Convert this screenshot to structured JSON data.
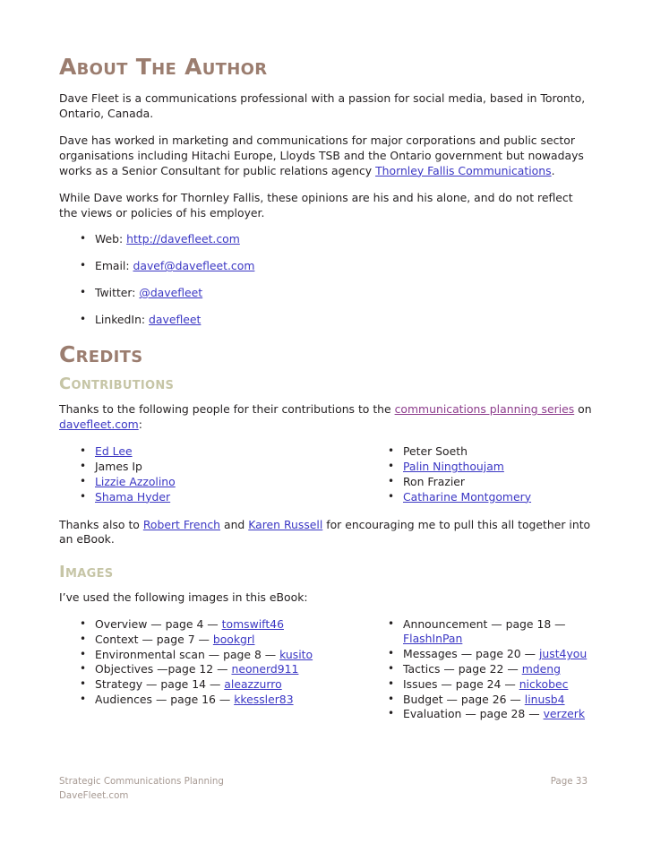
{
  "document": {
    "sections": {
      "author": {
        "heading": "About The Author",
        "paragraph_1": "Dave Fleet is a communications professional with a passion for social media, based in Toronto, Ontario, Canada.",
        "paragraph_2_part_1": "Dave has worked in marketing and communications for major corporations and public sector organisations including Hitachi Europe, Lloyds TSB and the Ontario government but nowadays works as a Senior Consultant for public relations agency ",
        "paragraph_2_link": "Thornley Fallis Communications",
        "paragraph_2_part_2": ".",
        "paragraph_3": "While Dave works for Thornley Fallis, these opinions are his and his alone, and do not reflect the views or policies of his employer.",
        "contacts": [
          {
            "label": "Web: ",
            "value": "http://davefleet.com",
            "is_link": true
          },
          {
            "label": "Email: ",
            "value": "davef@davefleet.com",
            "is_link": true
          },
          {
            "label": "Twitter: ",
            "value": "@davefleet",
            "is_link": true
          },
          {
            "label": "LinkedIn: ",
            "value": "davefleet",
            "is_link": true
          }
        ]
      },
      "credits": {
        "heading": "Credits",
        "contributions": {
          "heading": "Contributions",
          "intro_part_1": "Thanks to the following people for their contributions to the ",
          "intro_link_1": "communications planning series",
          "intro_part_2": " on ",
          "intro_link_2": "davefleet.com",
          "intro_part_3": ":",
          "people_left": [
            {
              "name": "Ed Lee",
              "is_link": true
            },
            {
              "name": "James Ip",
              "is_link": false
            },
            {
              "name": "Lizzie Azzolino",
              "is_link": true
            },
            {
              "name": "Shama Hyder",
              "is_link": true
            }
          ],
          "people_right": [
            {
              "name": "Peter Soeth",
              "is_link": false
            },
            {
              "name": "Palin Ningthoujam",
              "is_link": true
            },
            {
              "name": "Ron Frazier",
              "is_link": false
            },
            {
              "name": "Catharine Montgomery",
              "is_link": true
            }
          ],
          "closing_part_1": "Thanks also to ",
          "closing_link_1": "Robert French",
          "closing_part_2": " and ",
          "closing_link_2": "Karen Russell",
          "closing_part_3": " for encouraging me to pull this all together into an eBook."
        },
        "images": {
          "heading": "Images",
          "intro": "I’ve used the following images in this eBook:",
          "credits_left": [
            {
              "text": "Overview — page 4 — ",
              "credit": "tomswift46"
            },
            {
              "text": "Context — page 7 — ",
              "credit": "bookgrl"
            },
            {
              "text": "Environmental scan — page 8 — ",
              "credit": "kusito"
            },
            {
              "text": "Objectives —page 12 — ",
              "credit": "neonerd911"
            },
            {
              "text": "Strategy — page 14 — ",
              "credit": "aleazzurro"
            },
            {
              "text": "Audiences — page 16 — ",
              "credit": "kkessler83"
            }
          ],
          "credits_right": [
            {
              "text": "Announcement — page 18 — ",
              "credit": "FlashInPan"
            },
            {
              "text": "Messages — page 20 — ",
              "credit": "just4you"
            },
            {
              "text": "Tactics — page 22 — ",
              "credit": "mdeng"
            },
            {
              "text": "Issues — page 24 — ",
              "credit": "nickobec"
            },
            {
              "text": "Budget — page 26 — ",
              "credit": "linusb4"
            },
            {
              "text": "Evaluation — page 28 — ",
              "credit": "verzerk"
            }
          ]
        }
      }
    },
    "footer": {
      "title": "Strategic Communications Planning",
      "page_label": "Page 33",
      "site": "DaveFleet.com"
    },
    "colors": {
      "heading_major": "#9b7d6f",
      "heading_minor": "#c6c5a6",
      "link": "#3b37c4",
      "link_visited": "#8d3c8c",
      "body_text": "#231f20",
      "footer_text": "#a79a93",
      "background": "#ffffff"
    }
  }
}
